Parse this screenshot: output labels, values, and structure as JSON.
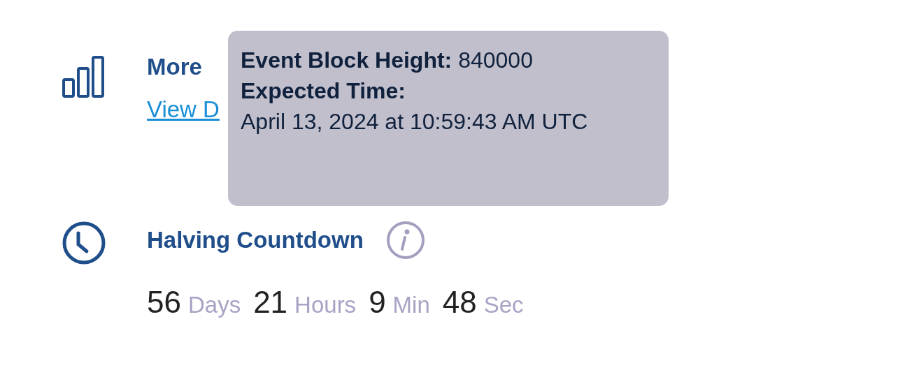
{
  "stats": {
    "title": "More",
    "link": "View D"
  },
  "tooltip": {
    "lines": [
      {
        "kind": "rich",
        "text": "**Event Block Height:** 840000"
      },
      {
        "kind": "heading",
        "text": "Expected Time:"
      },
      {
        "kind": "plain",
        "text": "April 13, 2024 at 10:59:43 AM UTC"
      }
    ]
  },
  "countdown": {
    "title": "Halving Countdown",
    "parts": [
      {
        "value": "56",
        "unit": "Days"
      },
      {
        "value": "21",
        "unit": "Hours"
      },
      {
        "value": "9",
        "unit": "Min"
      },
      {
        "value": "48",
        "unit": "Sec"
      }
    ]
  }
}
